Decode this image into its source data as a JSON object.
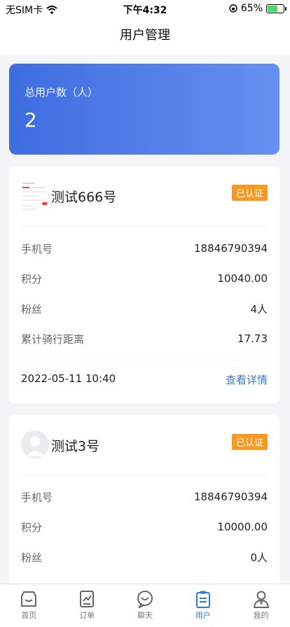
{
  "status_bar": {
    "carrier": "无SIM卡",
    "time": "下午4:32",
    "battery": "65%",
    "battery_level": 0.65
  },
  "header": {
    "title": "用户管理"
  },
  "summary": {
    "label": "总用户数（人）",
    "value": "2"
  },
  "users": [
    {
      "name": "测试666号",
      "badge": "已认证",
      "fields": [
        {
          "label": "手机号",
          "value": "18846790394"
        },
        {
          "label": "积分",
          "value": "10040.00"
        },
        {
          "label": "粉丝",
          "value": "4人"
        },
        {
          "label": "累计骑行距离",
          "value": "17.73"
        }
      ],
      "date": "2022-05-11 10:40",
      "detail_label": "查看详情"
    },
    {
      "name": "测试3号",
      "badge": "已认证",
      "fields": [
        {
          "label": "手机号",
          "value": "18846790394"
        },
        {
          "label": "积分",
          "value": "10000.00"
        },
        {
          "label": "粉丝",
          "value": "0人"
        }
      ]
    }
  ],
  "tabs": [
    {
      "label": "首页",
      "icon": "home-icon"
    },
    {
      "label": "订单",
      "icon": "order-icon"
    },
    {
      "label": "聊天",
      "icon": "chat-icon"
    },
    {
      "label": "用户",
      "icon": "user-list-icon"
    },
    {
      "label": "我的",
      "icon": "profile-icon"
    }
  ],
  "colors": {
    "accent": "#2f79d8",
    "badge": "#f59a23",
    "card_gradient_start": "#3f6de0",
    "card_gradient_end": "#6690f0"
  }
}
